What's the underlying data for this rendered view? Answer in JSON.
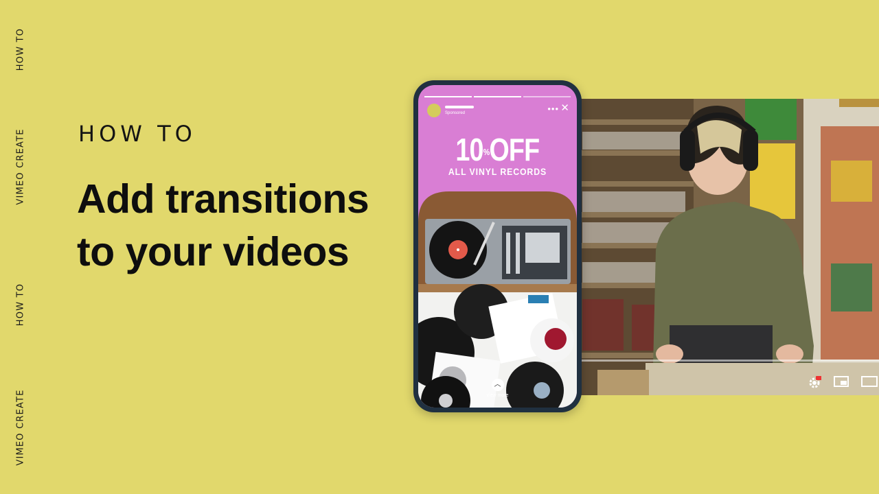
{
  "side_labels": [
    "HOW TO",
    "VIMEO CREATE",
    "HOW TO",
    "VIMEO CREATE"
  ],
  "eyebrow": "HOW TO",
  "title_lines": [
    "Add transitions",
    "to your videos"
  ],
  "phone": {
    "sponsored": "Sponsored",
    "promo_main": "10",
    "promo_sup": "%",
    "promo_off": "OFF",
    "promo_sub": "ALL VINYL RECORDS",
    "view_more": "view more",
    "progress_segments": 3,
    "progress_active": 2
  },
  "video": {
    "controls": [
      "settings-icon",
      "miniplayer-icon",
      "theater-icon"
    ],
    "settings_badge": "HD"
  },
  "colors": {
    "background": "#e1d86c",
    "phone_screen": "#d97ed4",
    "phone_frame": "#203040"
  }
}
